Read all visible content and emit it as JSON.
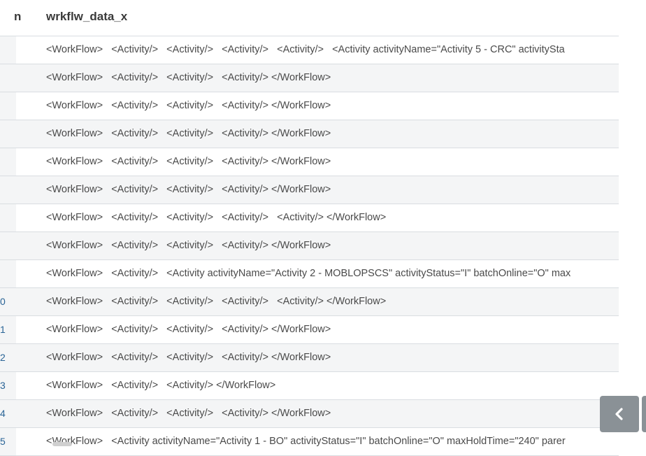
{
  "header": {
    "prev_column_fragment": "n",
    "column_title": "wrkflw_data_x"
  },
  "rows": [
    {
      "index": "",
      "value": "<WorkFlow>   <Activity/>   <Activity/>   <Activity/>   <Activity/>   <Activity activityName=\"Activity 5 - CRC\" activitySta"
    },
    {
      "index": "",
      "value": "<WorkFlow>   <Activity/>   <Activity/>   <Activity/> </WorkFlow>"
    },
    {
      "index": "",
      "value": "<WorkFlow>   <Activity/>   <Activity/>   <Activity/> </WorkFlow>"
    },
    {
      "index": "",
      "value": "<WorkFlow>   <Activity/>   <Activity/>   <Activity/> </WorkFlow>"
    },
    {
      "index": "",
      "value": "<WorkFlow>   <Activity/>   <Activity/>   <Activity/> </WorkFlow>"
    },
    {
      "index": "",
      "value": "<WorkFlow>   <Activity/>   <Activity/>   <Activity/> </WorkFlow>"
    },
    {
      "index": "",
      "value": "<WorkFlow>   <Activity/>   <Activity/>   <Activity/>   <Activity/> </WorkFlow>"
    },
    {
      "index": "",
      "value": "<WorkFlow>   <Activity/>   <Activity/>   <Activity/> </WorkFlow>"
    },
    {
      "index": "",
      "value": "<WorkFlow>   <Activity/>   <Activity activityName=\"Activity 2 - MOBLOPSCS\" activityStatus=\"I\" batchOnline=\"O\" max"
    },
    {
      "index": "0",
      "value": "<WorkFlow>   <Activity/>   <Activity/>   <Activity/>   <Activity/> </WorkFlow>"
    },
    {
      "index": "1",
      "value": "<WorkFlow>   <Activity/>   <Activity/>   <Activity/> </WorkFlow>"
    },
    {
      "index": "2",
      "value": "<WorkFlow>   <Activity/>   <Activity/>   <Activity/> </WorkFlow>"
    },
    {
      "index": "3",
      "value": "<WorkFlow>   <Activity/>   <Activity/> </WorkFlow>"
    },
    {
      "index": "4",
      "value": "<WorkFlow>   <Activity/>   <Activity/>   <Activity/> </WorkFlow>"
    },
    {
      "index": "5",
      "value": "<WorkFlow>   <Activity activityName=\"Activity 1 - BO\" activityStatus=\"I\" batchOnline=\"O\" maxHoldTime=\"240\" parer"
    }
  ],
  "nav": {
    "icon": "chevron-left-icon"
  },
  "colors": {
    "accent": "#1f6fa3",
    "index_link": "#2a6496",
    "nav_button": "#8a9196"
  }
}
